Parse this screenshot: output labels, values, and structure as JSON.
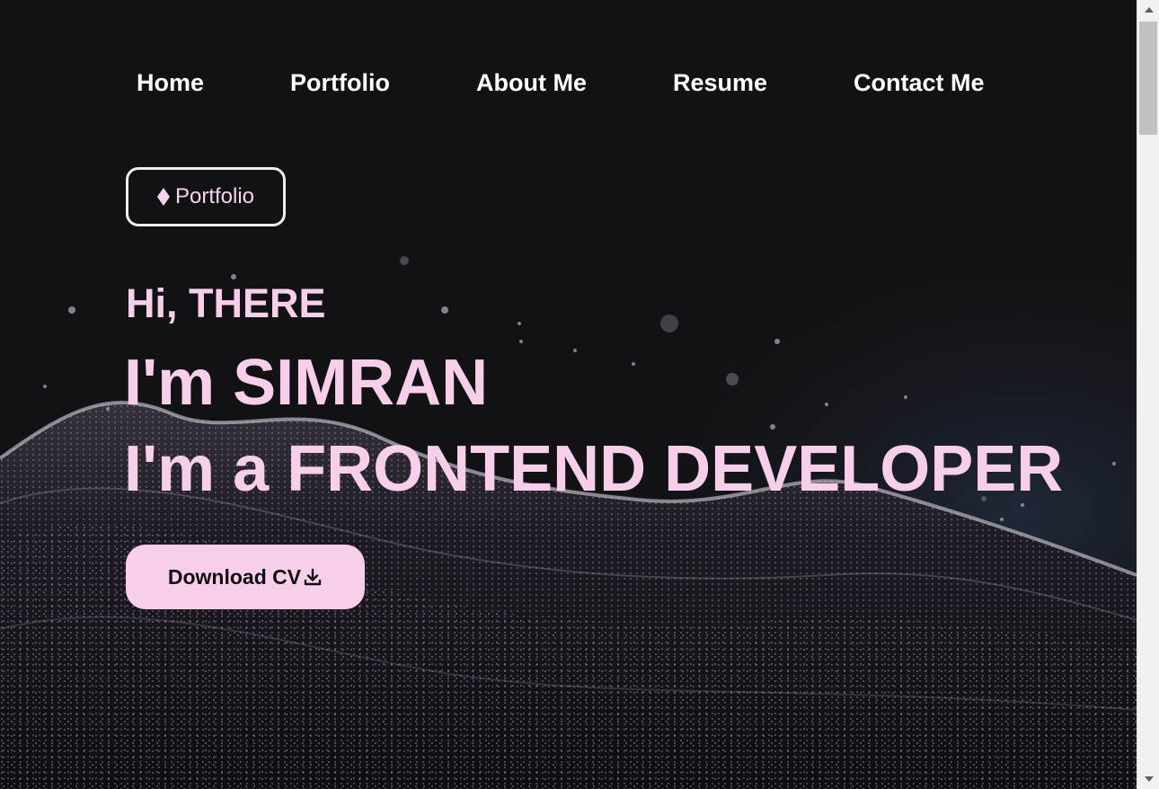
{
  "nav": {
    "items": [
      "Home",
      "Portfolio",
      "About Me",
      "Resume",
      "Contact Me"
    ]
  },
  "hero": {
    "badge_icon": "diamond-icon",
    "badge_label": "Portfolio",
    "greeting": "Hi, THERE",
    "line1": "I'm SIMRAN",
    "line2": "I'm a FRONTEND DEVELOPER",
    "cta_label": "Download CV",
    "cta_icon": "download-icon"
  },
  "colors": {
    "background": "#121214",
    "accent_pink": "#f8cfea",
    "nav_text": "#ffffff"
  }
}
